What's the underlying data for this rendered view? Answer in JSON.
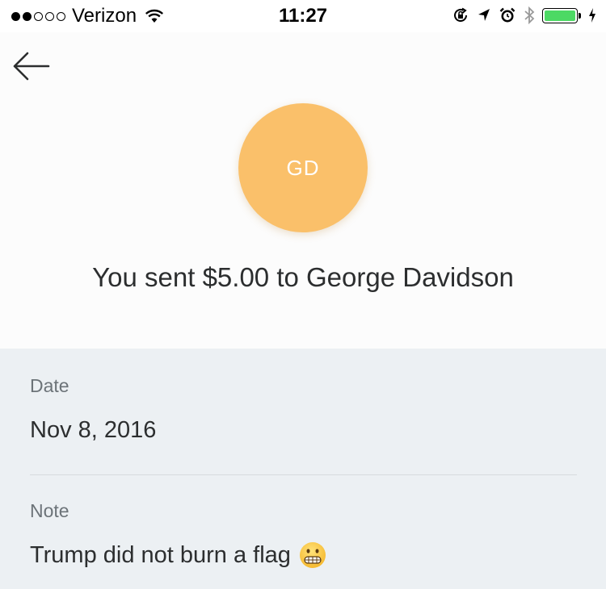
{
  "status_bar": {
    "carrier": "Verizon",
    "time": "11:27",
    "signal_bars_filled": 2,
    "signal_bars_total": 5,
    "battery_level": 1.0,
    "battery_color": "#4cd964"
  },
  "header": {
    "back_icon": "back-arrow-icon"
  },
  "recipient": {
    "initials": "GD",
    "avatar_color": "#fac06a"
  },
  "transaction": {
    "headline": "You sent $5.00 to George Davidson"
  },
  "details": {
    "date_label": "Date",
    "date_value": "Nov 8, 2016",
    "note_label": "Note",
    "note_value": "Trump did not burn a flag",
    "note_emoji": "grimacing-face-icon"
  }
}
